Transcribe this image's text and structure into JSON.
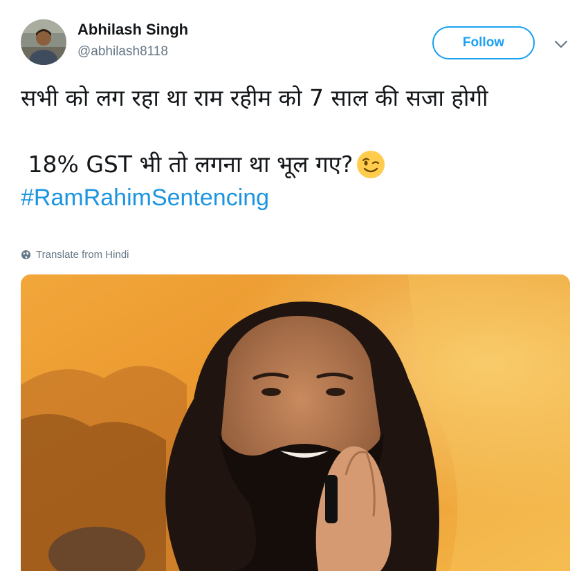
{
  "tweet": {
    "author": {
      "display_name": "Abhilash Singh",
      "handle": "@abhilash8118",
      "avatar_icon": "avatar-photo"
    },
    "follow_label": "Follow",
    "menu_icon": "chevron-down-icon",
    "text": {
      "line_1": "सभी को लग रहा था राम रहीम को 7 साल की सजा होगी",
      "line_2": " 18% GST भी तो लगना था भूल गए?",
      "emoji": "winking-face",
      "hashtag": "#RamRahimSentencing"
    },
    "translate_label": "Translate from Hindi",
    "media": {
      "type": "photo",
      "subject": "smiling bearded man with folded hands"
    }
  },
  "colors": {
    "accent": "#1da1f2",
    "hashtag": "#1b95e0",
    "secondary_text": "#657786",
    "primary_text": "#14171a"
  }
}
